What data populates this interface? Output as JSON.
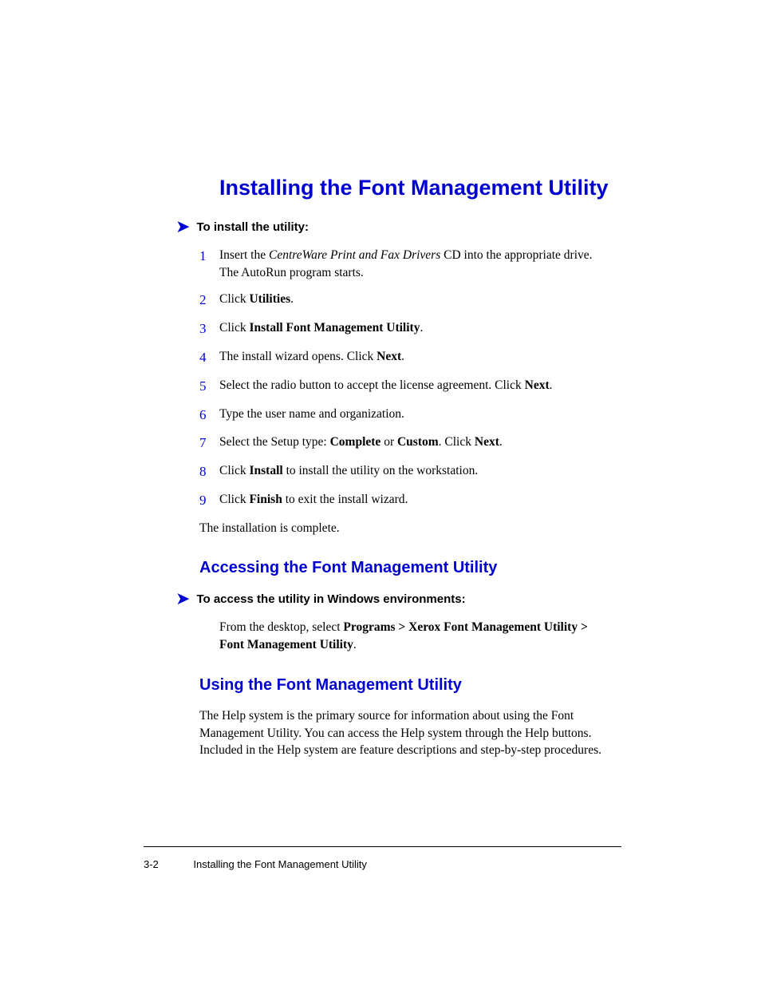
{
  "h1": "Installing the Font Management Utility",
  "install_heading": "To install the utility:",
  "steps": {
    "s1": {
      "num": "1",
      "pre": "Insert the ",
      "italic": "CentreWare Print and Fax Drivers",
      "post": " CD into the appropriate drive. The AutoRun program starts."
    },
    "s2": {
      "num": "2",
      "pre": "Click ",
      "bold": "Utilities",
      "post": "."
    },
    "s3": {
      "num": "3",
      "pre": "Click ",
      "bold": "Install Font Management Utility",
      "post": "."
    },
    "s4": {
      "num": "4",
      "pre": "The install wizard opens. Click ",
      "bold": "Next",
      "post": "."
    },
    "s5": {
      "num": "5",
      "pre": "Select the radio button to accept the license agreement. Click ",
      "bold": "Next",
      "post": "."
    },
    "s6": {
      "num": "6",
      "text": "Type the user name and organization."
    },
    "s7": {
      "num": "7",
      "pre": "Select the Setup type: ",
      "b1": "Complete",
      "mid": " or ",
      "b2": "Custom",
      "post1": ". Click ",
      "b3": "Next",
      "post2": "."
    },
    "s8": {
      "num": "8",
      "pre": "Click ",
      "bold": "Install",
      "post": " to install the utility on the workstation."
    },
    "s9": {
      "num": "9",
      "pre": "Click ",
      "bold": "Finish",
      "post": " to exit the install wizard."
    }
  },
  "complete_text": "The installation is complete.",
  "h2_access": "Accessing the Font Management Utility",
  "access_heading": "To access the utility in Windows environments:",
  "access_body": {
    "pre": "From the desktop, select ",
    "bold": "Programs > Xerox Font Management Utility > Font Management Utility",
    "post": "."
  },
  "h2_using": "Using the Font Management Utility",
  "using_body": "The Help system is the primary source for information about using the Font Management Utility. You can access the Help system through the Help buttons. Included in the Help system are feature descriptions and step-by-step procedures.",
  "footer": {
    "page": "3-2",
    "title": "Installing the Font Management Utility"
  }
}
